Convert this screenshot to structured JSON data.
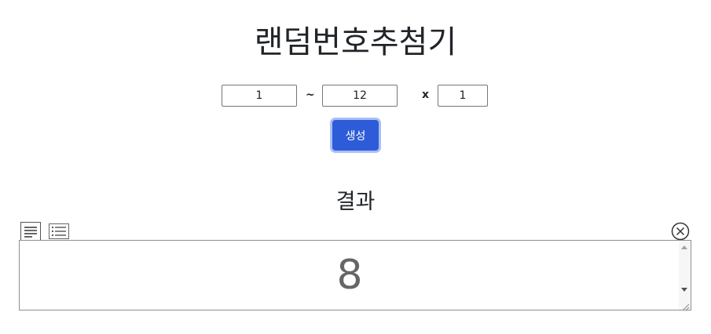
{
  "title": "랜덤번호추첨기",
  "range": {
    "min_value": "1",
    "separator": "~",
    "max_value": "12",
    "times_label": "x",
    "count_value": "1"
  },
  "generate_button_label": "생성",
  "result": {
    "heading": "결과",
    "value": "8"
  },
  "colors": {
    "button": "#2e5bd8",
    "button_focus_ring": "#a8bff5",
    "result_text": "#666666"
  },
  "icons": [
    "text-view-icon",
    "list-view-icon",
    "close-circle-icon",
    "scroll-up-icon",
    "scroll-down-icon",
    "resize-grip-icon"
  ]
}
